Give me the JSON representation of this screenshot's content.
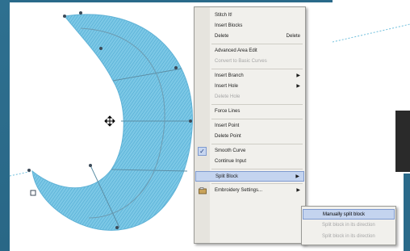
{
  "app": {
    "background_color": "#2a6a8a",
    "shape_color": "#79c8e8"
  },
  "context_menu": {
    "items": [
      {
        "label": "Stitch It!",
        "shortcut": "",
        "submenu": false,
        "disabled": false
      },
      {
        "label": "Insert Blocks",
        "shortcut": "",
        "submenu": false,
        "disabled": false
      },
      {
        "label": "Delete",
        "shortcut": "Delete",
        "submenu": false,
        "disabled": false
      },
      {
        "separator": true
      },
      {
        "label": "Advanced Area Edit",
        "shortcut": "",
        "submenu": false,
        "disabled": false
      },
      {
        "label": "Convert to Basic Curves",
        "shortcut": "",
        "submenu": false,
        "disabled": true
      },
      {
        "separator": true
      },
      {
        "label": "Insert Branch",
        "shortcut": "",
        "submenu": true,
        "disabled": false
      },
      {
        "label": "Insert Hole",
        "shortcut": "",
        "submenu": true,
        "disabled": false
      },
      {
        "label": "Delete Hole",
        "shortcut": "",
        "submenu": false,
        "disabled": true
      },
      {
        "separator": true
      },
      {
        "label": "Force Lines",
        "shortcut": "",
        "submenu": false,
        "disabled": false
      },
      {
        "separator": true
      },
      {
        "label": "Insert Point",
        "shortcut": "",
        "submenu": false,
        "disabled": false
      },
      {
        "label": "Delete Point",
        "shortcut": "",
        "submenu": false,
        "disabled": false
      },
      {
        "separator": true
      },
      {
        "label": "Smooth Curve",
        "shortcut": "",
        "submenu": false,
        "disabled": false,
        "checked": true
      },
      {
        "label": "Continue Input",
        "shortcut": "",
        "submenu": false,
        "disabled": false
      },
      {
        "separator": true
      },
      {
        "label": "Split Block",
        "shortcut": "",
        "submenu": true,
        "disabled": false,
        "selected": true
      },
      {
        "separator": true
      },
      {
        "label": "Embroidery Settings...",
        "shortcut": "",
        "submenu": true,
        "disabled": false,
        "icon": "embroidery-settings-icon"
      }
    ]
  },
  "split_submenu": {
    "items": [
      {
        "label": "Manually split block",
        "selected": true,
        "disabled": false
      },
      {
        "label": "Split block in its direction",
        "selected": false,
        "disabled": true
      },
      {
        "label": "Split block in its direction",
        "selected": false,
        "disabled": true
      }
    ]
  }
}
